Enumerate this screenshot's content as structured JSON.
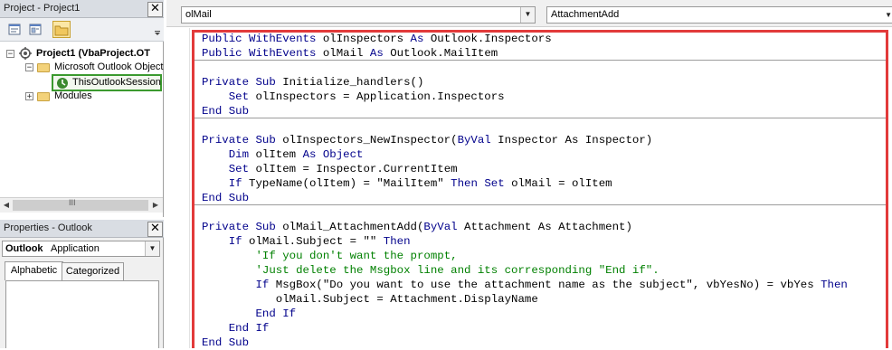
{
  "project_pane": {
    "title": "Project - Project1",
    "tree": {
      "root": "Project1 (VbaProject.OT",
      "folder_outlook": "Microsoft Outlook Object",
      "session": "ThisOutlookSession",
      "folder_modules": "Modules"
    },
    "scroll_grip": "III"
  },
  "properties_pane": {
    "title": "Properties - Outlook",
    "object_name": "Outlook",
    "object_type": "Application",
    "tabs": [
      "Alphabetic",
      "Categorized"
    ]
  },
  "code_window": {
    "object_combo": "olMail",
    "procedure_combo": "AttachmentAdd",
    "lines": [
      {
        "pre": "",
        "kw1": "Public WithEvents",
        "mid": " olInspectors ",
        "kw2": "As",
        "post": " Outlook.Inspectors"
      },
      {
        "pre": "",
        "kw1": "Public WithEvents",
        "mid": " olMail ",
        "kw2": "As",
        "post": " Outlook.MailItem"
      },
      {
        "pre": "",
        "kw1": "Private Sub",
        "mid": " Initialize_handlers()",
        "kw2": "",
        "post": ""
      },
      {
        "pre": "    ",
        "kw1": "Set",
        "mid": " olInspectors = Application.Inspectors",
        "kw2": "",
        "post": ""
      },
      {
        "pre": "",
        "kw1": "End Sub",
        "mid": "",
        "kw2": "",
        "post": ""
      },
      {
        "pre": "",
        "kw1": "Private Sub",
        "mid": " olInspectors_NewInspector(",
        "kw2": "ByVal",
        "post": " Inspector As Inspector)"
      },
      {
        "pre": "    ",
        "kw1": "Dim",
        "mid": " olItem ",
        "kw2": "As Object",
        "post": ""
      },
      {
        "pre": "    ",
        "kw1": "Set",
        "mid": " olItem = Inspector.CurrentItem",
        "kw2": "",
        "post": ""
      },
      {
        "pre": "    ",
        "kw1": "If",
        "mid": " TypeName(olItem) = \"MailItem\" ",
        "kw2": "Then Set",
        "post": " olMail = olItem"
      },
      {
        "pre": "",
        "kw1": "End Sub",
        "mid": "",
        "kw2": "",
        "post": ""
      },
      {
        "pre": "",
        "kw1": "Private Sub",
        "mid": " olMail_AttachmentAdd(",
        "kw2": "ByVal",
        "post": " Attachment As Attachment)"
      },
      {
        "pre": "    ",
        "kw1": "If",
        "mid": " olMail.Subject = \"\" ",
        "kw2": "Then",
        "post": ""
      },
      {
        "pre": "        ",
        "comment": "'If you don't want the prompt,"
      },
      {
        "pre": "        ",
        "comment": "'Just delete the Msgbox line and its corresponding \"End if\"."
      },
      {
        "pre": "        ",
        "kw1": "If",
        "mid": " MsgBox(\"Do you want to use the attachment name as the subject\", vbYesNo) = vbYes ",
        "kw2": "Then",
        "post": ""
      },
      {
        "pre": "           ",
        "kw1": "",
        "mid": "olMail.Subject = Attachment.DisplayName",
        "kw2": "",
        "post": ""
      },
      {
        "pre": "        ",
        "kw1": "End If",
        "mid": "",
        "kw2": "",
        "post": ""
      },
      {
        "pre": "    ",
        "kw1": "End If",
        "mid": "",
        "kw2": "",
        "post": ""
      },
      {
        "pre": "",
        "kw1": "End Sub",
        "mid": "",
        "kw2": "",
        "post": ""
      }
    ]
  },
  "icons": {
    "close": "close-icon",
    "view_code": "view-code-icon",
    "view_object": "view-object-icon",
    "toggle_folders": "toggle-folders-icon"
  },
  "colors": {
    "keyword": "#00008b",
    "comment": "#008000",
    "highlight_box": "#e23a3a",
    "selection_box": "#3b9a2f"
  }
}
